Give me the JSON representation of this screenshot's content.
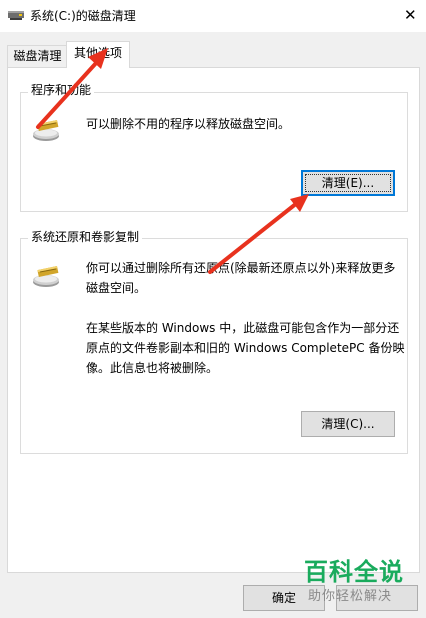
{
  "window": {
    "title": "系统(C:)的磁盘清理",
    "close_glyph": "✕"
  },
  "tabs": [
    {
      "label": "磁盘清理",
      "active": false
    },
    {
      "label": "其他选项",
      "active": true
    }
  ],
  "programs_group": {
    "title": "程序和功能",
    "description": "可以删除不用的程序以释放磁盘空间。",
    "button_label": "清理(E)...",
    "icon": "disk-cleanup-icon"
  },
  "restore_group": {
    "title": "系统还原和卷影复制",
    "description1": "你可以通过删除所有还原点(除最新还原点以外)来释放更多磁盘空间。",
    "description2": "在某些版本的 Windows 中，此磁盘可能包含作为一部分还原点的文件卷影副本和旧的 Windows CompletePC 备份映像。此信息也将被删除。",
    "button_label": "清理(C)...",
    "icon": "disk-cleanup-icon"
  },
  "footer": {
    "ok_label": "确定",
    "cancel_label": ""
  },
  "watermark": {
    "brand": "百科全说",
    "tagline": "助你轻松解决"
  },
  "colors": {
    "arrow": "#e8321e",
    "focus": "#0078d7",
    "watermark_green": "#1aab5d"
  }
}
